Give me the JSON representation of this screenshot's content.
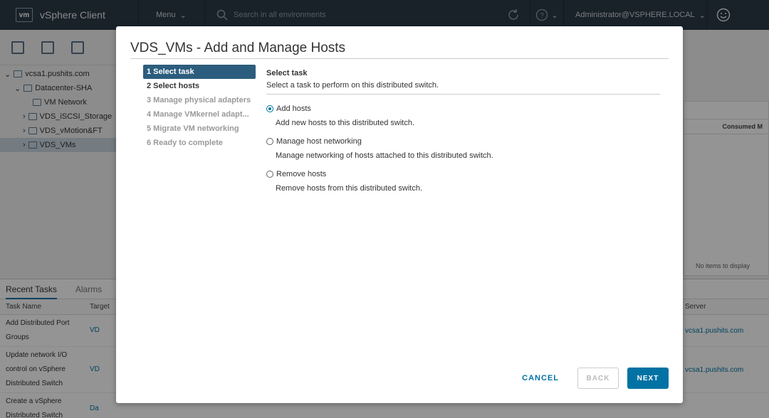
{
  "topbar": {
    "logo": "vm",
    "app_name": "vSphere Client",
    "menu_label": "Menu",
    "search_placeholder": "Search in all environments",
    "user": "Administrator@VSPHERE.LOCAL"
  },
  "tree": {
    "items": [
      {
        "label": "vcsa1.pushits.com"
      },
      {
        "label": "Datacenter-SHA"
      },
      {
        "label": "VM Network"
      },
      {
        "label": "VDS_iSCSI_Storage"
      },
      {
        "label": "VDS_vMotion&FT"
      },
      {
        "label": "VDS_VMs"
      }
    ]
  },
  "right_panel": {
    "col_label": "Consumed M",
    "no_items": "No items to display"
  },
  "tasks": {
    "tab_recent": "Recent Tasks",
    "tab_alarms": "Alarms",
    "col_task_name": "Task Name",
    "col_target": "Target",
    "col_server": "Server",
    "rows": [
      {
        "name": "Add Distributed Port Groups",
        "target": "VD",
        "server": "vcsa1.pushits.com"
      },
      {
        "name": "Update network I/O control on vSphere Distributed Switch",
        "target": "VD",
        "server": "vcsa1.pushits.com"
      },
      {
        "name": "Create a vSphere Distributed Switch",
        "target": "Da",
        "server": ""
      }
    ]
  },
  "modal": {
    "title": "VDS_VMs - Add and Manage Hosts",
    "steps": [
      {
        "label": "1 Select task"
      },
      {
        "label": "2 Select hosts"
      },
      {
        "label": "3 Manage physical adapters"
      },
      {
        "label": "4 Manage VMkernel adapt..."
      },
      {
        "label": "5 Migrate VM networking"
      },
      {
        "label": "6 Ready to complete"
      }
    ],
    "section_title": "Select task",
    "section_desc": "Select a task to perform on this distributed switch.",
    "options": [
      {
        "label": "Add hosts",
        "desc": "Add new hosts to this distributed switch.",
        "checked": true
      },
      {
        "label": "Manage host networking",
        "desc": "Manage networking of hosts attached to this distributed switch.",
        "checked": false
      },
      {
        "label": "Remove hosts",
        "desc": "Remove hosts from this distributed switch.",
        "checked": false
      }
    ],
    "cancel_label": "CANCEL",
    "back_label": "BACK",
    "next_label": "NEXT"
  },
  "colors": {
    "accent": "#0072a3",
    "active_step": "#2d5d7e",
    "topbar": "#2b3a47"
  }
}
